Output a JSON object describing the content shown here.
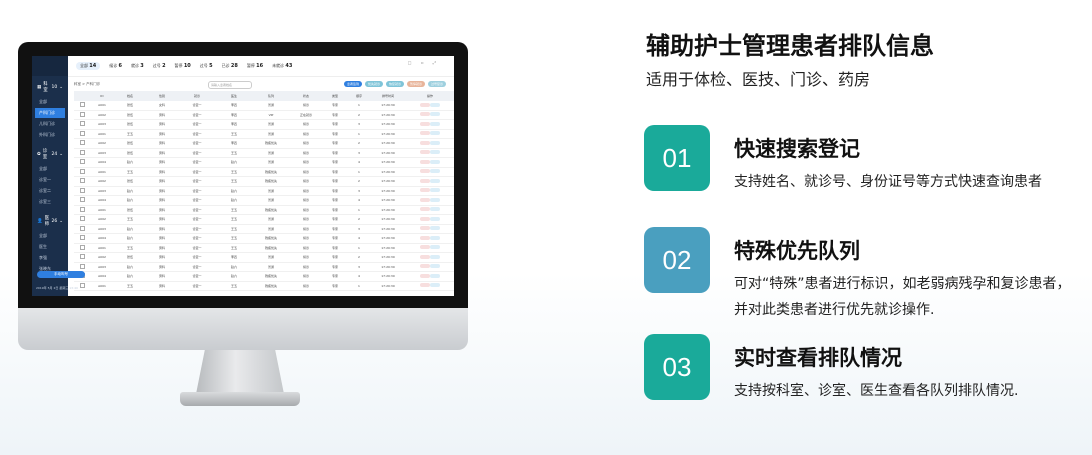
{
  "heading": {
    "title": "辅助护士管理患者排队信息",
    "subtitle": "适用于体检、医技、门诊、药房"
  },
  "features": [
    {
      "number": "01",
      "title": "快速搜索登记",
      "desc": "支持姓名、就诊号、身份证号等方式快速查询患者",
      "color": "#1aaa9a"
    },
    {
      "number": "02",
      "title": "特殊优先队列",
      "desc": "可对“特殊”患者进行标识，如老弱病残孕和复诊患者，并对此类患者进行优先就诊操作.",
      "color": "#4a9fbf"
    },
    {
      "number": "03",
      "title": "实时查看排队情况",
      "desc": "支持按科室、诊室、医生查看各队列排队情况.",
      "color": "#1aaa9a"
    }
  ],
  "screen": {
    "topbar": [
      {
        "label": "全部",
        "count": "14"
      },
      {
        "label": "候诊",
        "count": "6"
      },
      {
        "label": "就诊",
        "count": "3"
      },
      {
        "label": "过号",
        "count": "2"
      },
      {
        "label": "暂停",
        "count": "10"
      },
      {
        "label": "过号",
        "count": "5"
      },
      {
        "label": "已诊",
        "count": "28"
      },
      {
        "label": "暂停",
        "count": "16"
      },
      {
        "label": "未就诊",
        "count": "43"
      }
    ],
    "window_controls": "□ ▫ ⤢",
    "breadcrumb": "科室 > 产科门诊",
    "search_placeholder": "请输入患者姓名",
    "toolbar_buttons": [
      {
        "label": "患者签到",
        "color": "#2f7fe0"
      },
      {
        "label": "优先就诊",
        "color": "#7fc4d8"
      },
      {
        "label": "恢复就诊",
        "color": "#7fc4d8"
      },
      {
        "label": "暂停就诊",
        "color": "#e8b49a"
      },
      {
        "label": "过号复诊",
        "color": "#9ed0df"
      }
    ],
    "sidebar": {
      "groups": [
        {
          "icon": "▦",
          "label": "科室",
          "count": "10",
          "items": [
            "全部",
            "产科门诊",
            "儿科门诊",
            "外科门诊"
          ],
          "active": 1
        },
        {
          "icon": "✿",
          "label": "诊室",
          "count": "24",
          "items": [
            "全部",
            "诊室一",
            "诊室二",
            "诊室三"
          ],
          "active": -1
        },
        {
          "icon": "👤",
          "label": "医师",
          "count": "26",
          "items": [
            "全部",
            "医生",
            "李强",
            "张晓东"
          ],
          "active": -1
        }
      ],
      "button": "手动叫号",
      "date": "2019年 5月 2日  星期三  13:40"
    },
    "table": {
      "headers": [
        "",
        "ID",
        "姓名",
        "性别",
        "就诊",
        "医生",
        "队列",
        "状态",
        "类型",
        "顺序",
        "排号时间",
        "操作"
      ],
      "rows": [
        [
          "A001",
          "张伍",
          "女科",
          "诊室一",
          "李四",
          "普通",
          "候诊",
          "专家",
          "1",
          "17:20:30"
        ],
        [
          "A002",
          "张伍",
          "男科",
          "诊室一",
          "李四",
          "VIP",
          "正在就诊",
          "专家",
          "2",
          "17:20:30"
        ],
        [
          "A003",
          "张伍",
          "男科",
          "诊室一",
          "李四",
          "普通",
          "候诊",
          "专家",
          "3",
          "17:20:30"
        ],
        [
          "A001",
          "王五",
          "男科",
          "诊室一",
          "王五",
          "普通",
          "候诊",
          "专家",
          "1",
          "17:20:30"
        ],
        [
          "A002",
          "张伍",
          "男科",
          "诊室一",
          "李四",
          "残疾优先",
          "候诊",
          "专家",
          "2",
          "17:20:30"
        ],
        [
          "A003",
          "张伍",
          "男科",
          "诊室一",
          "王五",
          "普通",
          "候诊",
          "专家",
          "3",
          "17:20:30"
        ],
        [
          "A004",
          "赵六",
          "男科",
          "诊室一",
          "赵六",
          "普通",
          "候诊",
          "专家",
          "4",
          "17:20:30"
        ],
        [
          "A001",
          "王五",
          "男科",
          "诊室一",
          "王五",
          "残疾优先",
          "候诊",
          "专家",
          "1",
          "17:20:30"
        ],
        [
          "A002",
          "张伍",
          "男科",
          "诊室一",
          "王五",
          "残疾优先",
          "候诊",
          "专家",
          "2",
          "17:20:30"
        ],
        [
          "A003",
          "赵六",
          "男科",
          "诊室一",
          "赵六",
          "普通",
          "候诊",
          "专家",
          "3",
          "17:20:30"
        ],
        [
          "A004",
          "赵六",
          "男科",
          "诊室一",
          "赵六",
          "普通",
          "候诊",
          "专家",
          "4",
          "17:20:30"
        ],
        [
          "A001",
          "张伍",
          "男科",
          "诊室一",
          "王五",
          "残疾优先",
          "候诊",
          "专家",
          "1",
          "17:20:30"
        ],
        [
          "A002",
          "王五",
          "男科",
          "诊室一",
          "王五",
          "普通",
          "候诊",
          "专家",
          "2",
          "17:20:30"
        ],
        [
          "A003",
          "赵六",
          "男科",
          "诊室一",
          "王五",
          "普通",
          "候诊",
          "专家",
          "3",
          "17:20:30"
        ],
        [
          "A004",
          "赵六",
          "男科",
          "诊室一",
          "王五",
          "残疾优先",
          "候诊",
          "专家",
          "4",
          "17:20:30"
        ],
        [
          "A001",
          "王五",
          "男科",
          "诊室一",
          "王五",
          "残疾优先",
          "候诊",
          "专家",
          "1",
          "17:20:30"
        ],
        [
          "A002",
          "张伍",
          "男科",
          "诊室一",
          "李四",
          "普通",
          "候诊",
          "专家",
          "2",
          "17:20:30"
        ],
        [
          "A003",
          "赵六",
          "男科",
          "诊室一",
          "赵六",
          "普通",
          "候诊",
          "专家",
          "3",
          "17:20:30"
        ],
        [
          "A004",
          "赵六",
          "男科",
          "诊室一",
          "赵六",
          "残疾优先",
          "候诊",
          "专家",
          "4",
          "17:20:30"
        ],
        [
          "A001",
          "王五",
          "男科",
          "诊室一",
          "王五",
          "残疾优先",
          "候诊",
          "专家",
          "1",
          "17:20:30"
        ]
      ]
    }
  }
}
